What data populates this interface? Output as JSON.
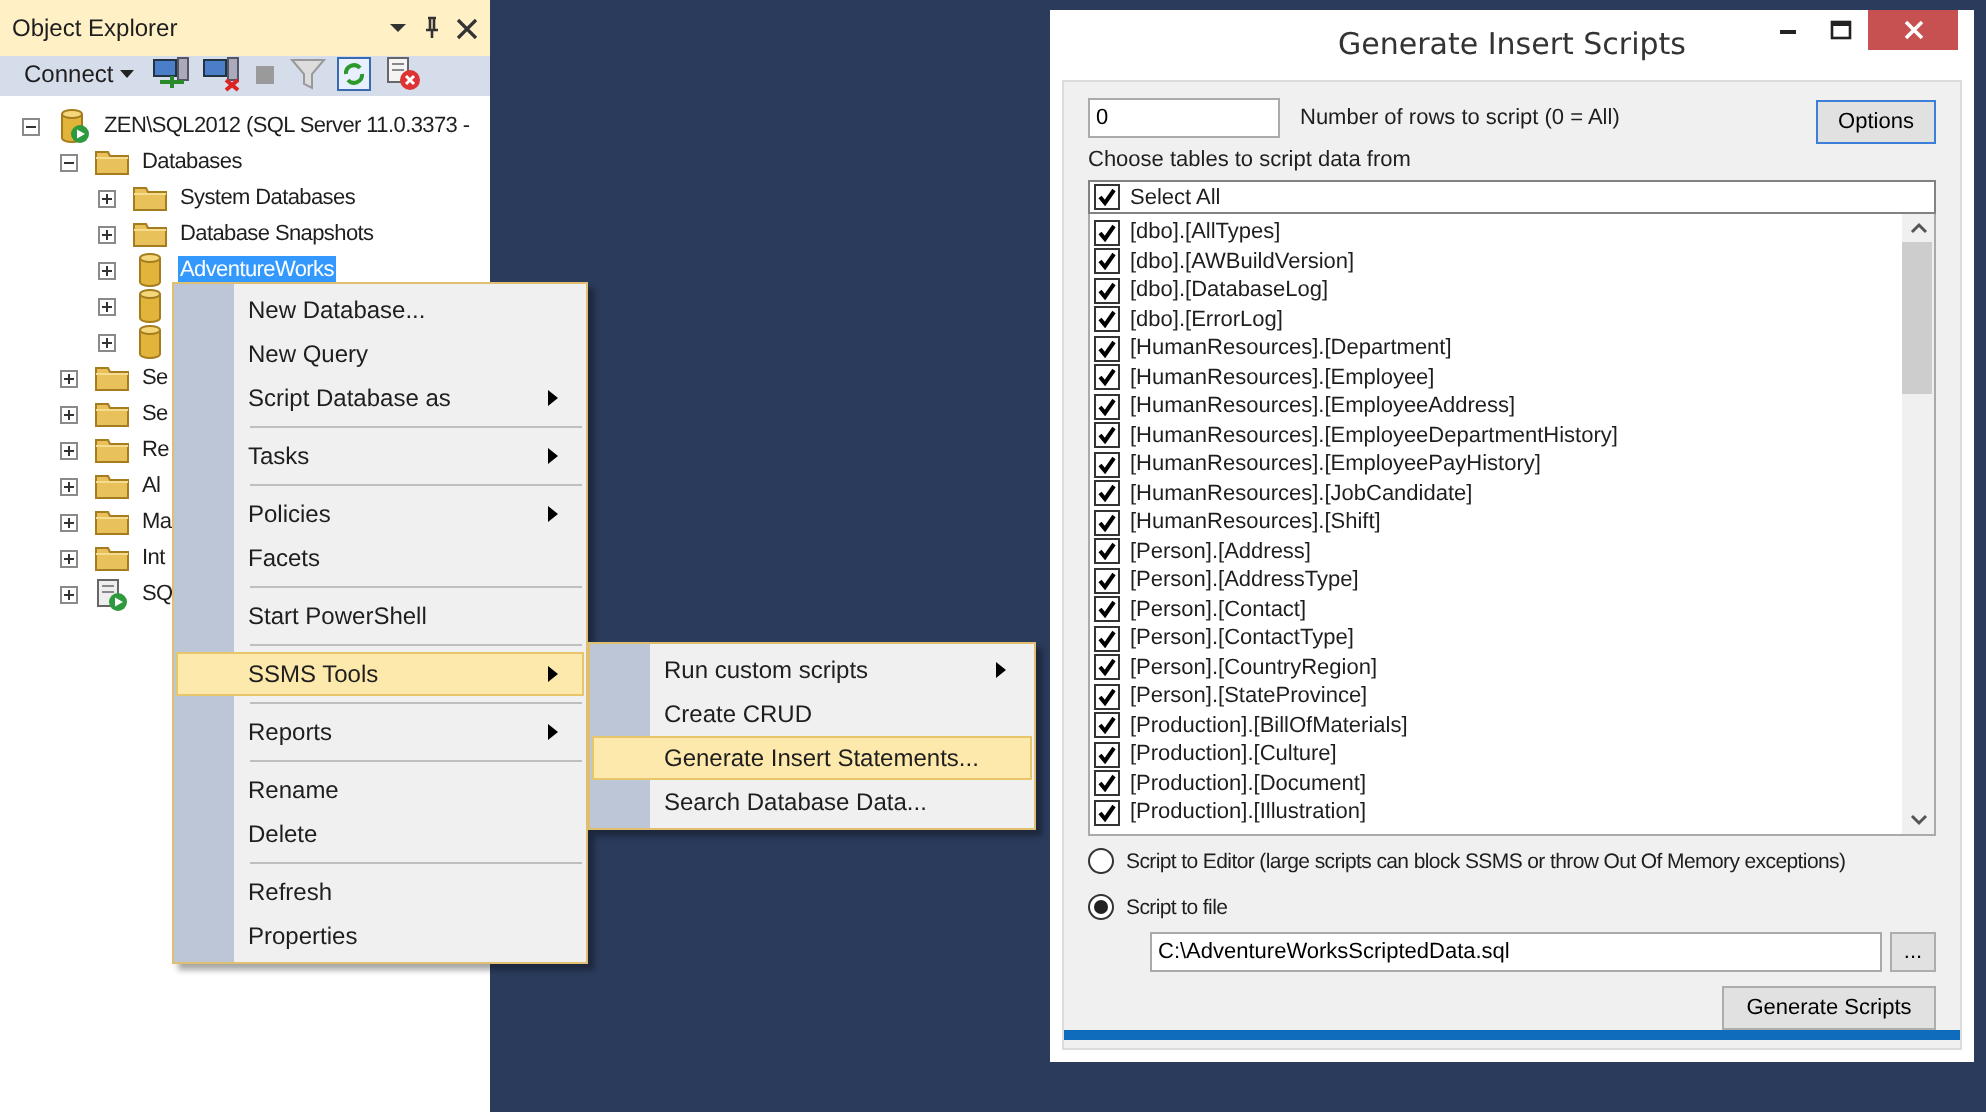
{
  "object_explorer": {
    "title": "Object Explorer",
    "connect": "Connect",
    "tree": [
      {
        "label": "ZEN\\SQL2012 (SQL Server 11.0.3373 -",
        "kind": "server",
        "expanded": true,
        "selected": false,
        "children": [
          {
            "label": "Databases",
            "kind": "folder",
            "expanded": true,
            "selected": false,
            "children": [
              {
                "label": "System Databases",
                "kind": "folder",
                "expanded": false,
                "selected": false
              },
              {
                "label": "Database Snapshots",
                "kind": "folder",
                "expanded": false,
                "selected": false
              },
              {
                "label": "AdventureWorks",
                "kind": "database",
                "expanded": false,
                "selected": true
              },
              {
                "kind": "database",
                "expanded": false
              },
              {
                "kind": "database",
                "expanded": false
              }
            ]
          },
          {
            "label": "Se",
            "kind": "folder",
            "expanded": false,
            "selected": false
          },
          {
            "label": "Se",
            "kind": "folder",
            "expanded": false,
            "selected": false
          },
          {
            "label": "Re",
            "kind": "folder",
            "expanded": false,
            "selected": false
          },
          {
            "label": "Al",
            "kind": "folder",
            "expanded": false,
            "selected": false
          },
          {
            "label": "Ma",
            "kind": "folder",
            "expanded": false,
            "selected": false
          },
          {
            "label": "Int",
            "kind": "folder",
            "expanded": false,
            "selected": false
          },
          {
            "label": "SQ",
            "kind": "agent",
            "expanded": false,
            "selected": false
          }
        ]
      }
    ]
  },
  "context_menu": {
    "items": [
      {
        "kind": "item",
        "label": "New Database...",
        "submenu": false,
        "selected": false
      },
      {
        "kind": "item",
        "label": "New Query",
        "submenu": false,
        "selected": false
      },
      {
        "kind": "item",
        "label": "Script Database as",
        "submenu": true,
        "selected": false
      },
      {
        "kind": "separator"
      },
      {
        "kind": "item",
        "label": "Tasks",
        "submenu": true,
        "selected": false
      },
      {
        "kind": "separator"
      },
      {
        "kind": "item",
        "label": "Policies",
        "submenu": true,
        "selected": false
      },
      {
        "kind": "item",
        "label": "Facets",
        "submenu": false,
        "selected": false
      },
      {
        "kind": "separator"
      },
      {
        "kind": "item",
        "label": "Start PowerShell",
        "submenu": false,
        "selected": false
      },
      {
        "kind": "separator"
      },
      {
        "kind": "item",
        "label": "SSMS Tools",
        "submenu": true,
        "selected": true
      },
      {
        "kind": "separator"
      },
      {
        "kind": "item",
        "label": "Reports",
        "submenu": true,
        "selected": false
      },
      {
        "kind": "separator"
      },
      {
        "kind": "item",
        "label": "Rename",
        "submenu": false,
        "selected": false
      },
      {
        "kind": "item",
        "label": "Delete",
        "submenu": false,
        "selected": false
      },
      {
        "kind": "separator"
      },
      {
        "kind": "item",
        "label": "Refresh",
        "submenu": false,
        "selected": false
      },
      {
        "kind": "item",
        "label": "Properties",
        "submenu": false,
        "selected": false
      }
    ]
  },
  "submenu": {
    "items": [
      {
        "kind": "item",
        "label": "Run custom scripts",
        "submenu": true,
        "selected": false
      },
      {
        "kind": "item",
        "label": "Create CRUD",
        "submenu": false,
        "selected": false
      },
      {
        "kind": "item",
        "label": "Generate Insert Statements...",
        "submenu": false,
        "selected": true
      },
      {
        "kind": "item",
        "label": "Search Database Data...",
        "submenu": false,
        "selected": false
      }
    ]
  },
  "dialog": {
    "title": "Generate Insert Scripts",
    "rows_field": {
      "value": "0"
    },
    "rows_label": "Number of rows to script (0 = All)",
    "options_button": "Options",
    "tables_label": "Choose tables to script data from",
    "select_all": {
      "label": "Select All",
      "checked": true
    },
    "tables": [
      {
        "label": "[dbo].[AllTypes]",
        "checked": true
      },
      {
        "label": "[dbo].[AWBuildVersion]",
        "checked": true
      },
      {
        "label": "[dbo].[DatabaseLog]",
        "checked": true
      },
      {
        "label": "[dbo].[ErrorLog]",
        "checked": true
      },
      {
        "label": "[HumanResources].[Department]",
        "checked": true
      },
      {
        "label": "[HumanResources].[Employee]",
        "checked": true
      },
      {
        "label": "[HumanResources].[EmployeeAddress]",
        "checked": true
      },
      {
        "label": "[HumanResources].[EmployeeDepartmentHistory]",
        "checked": true
      },
      {
        "label": "[HumanResources].[EmployeePayHistory]",
        "checked": true
      },
      {
        "label": "[HumanResources].[JobCandidate]",
        "checked": true
      },
      {
        "label": "[HumanResources].[Shift]",
        "checked": true
      },
      {
        "label": "[Person].[Address]",
        "checked": true
      },
      {
        "label": "[Person].[AddressType]",
        "checked": true
      },
      {
        "label": "[Person].[Contact]",
        "checked": true
      },
      {
        "label": "[Person].[ContactType]",
        "checked": true
      },
      {
        "label": "[Person].[CountryRegion]",
        "checked": true
      },
      {
        "label": "[Person].[StateProvince]",
        "checked": true
      },
      {
        "label": "[Production].[BillOfMaterials]",
        "checked": true
      },
      {
        "label": "[Production].[Culture]",
        "checked": true
      },
      {
        "label": "[Production].[Document]",
        "checked": true
      },
      {
        "label": "[Production].[Illustration]",
        "checked": true
      }
    ],
    "output_options": [
      {
        "label": "Script to Editor (large scripts can block SSMS or throw Out Of Memory exceptions)",
        "selected": false
      },
      {
        "label": "Script to file",
        "selected": true
      }
    ],
    "file_path": {
      "value": "C:\\AdventureWorksScriptedData.sql"
    },
    "browse_button": "...",
    "generate_button": "Generate Scripts"
  }
}
